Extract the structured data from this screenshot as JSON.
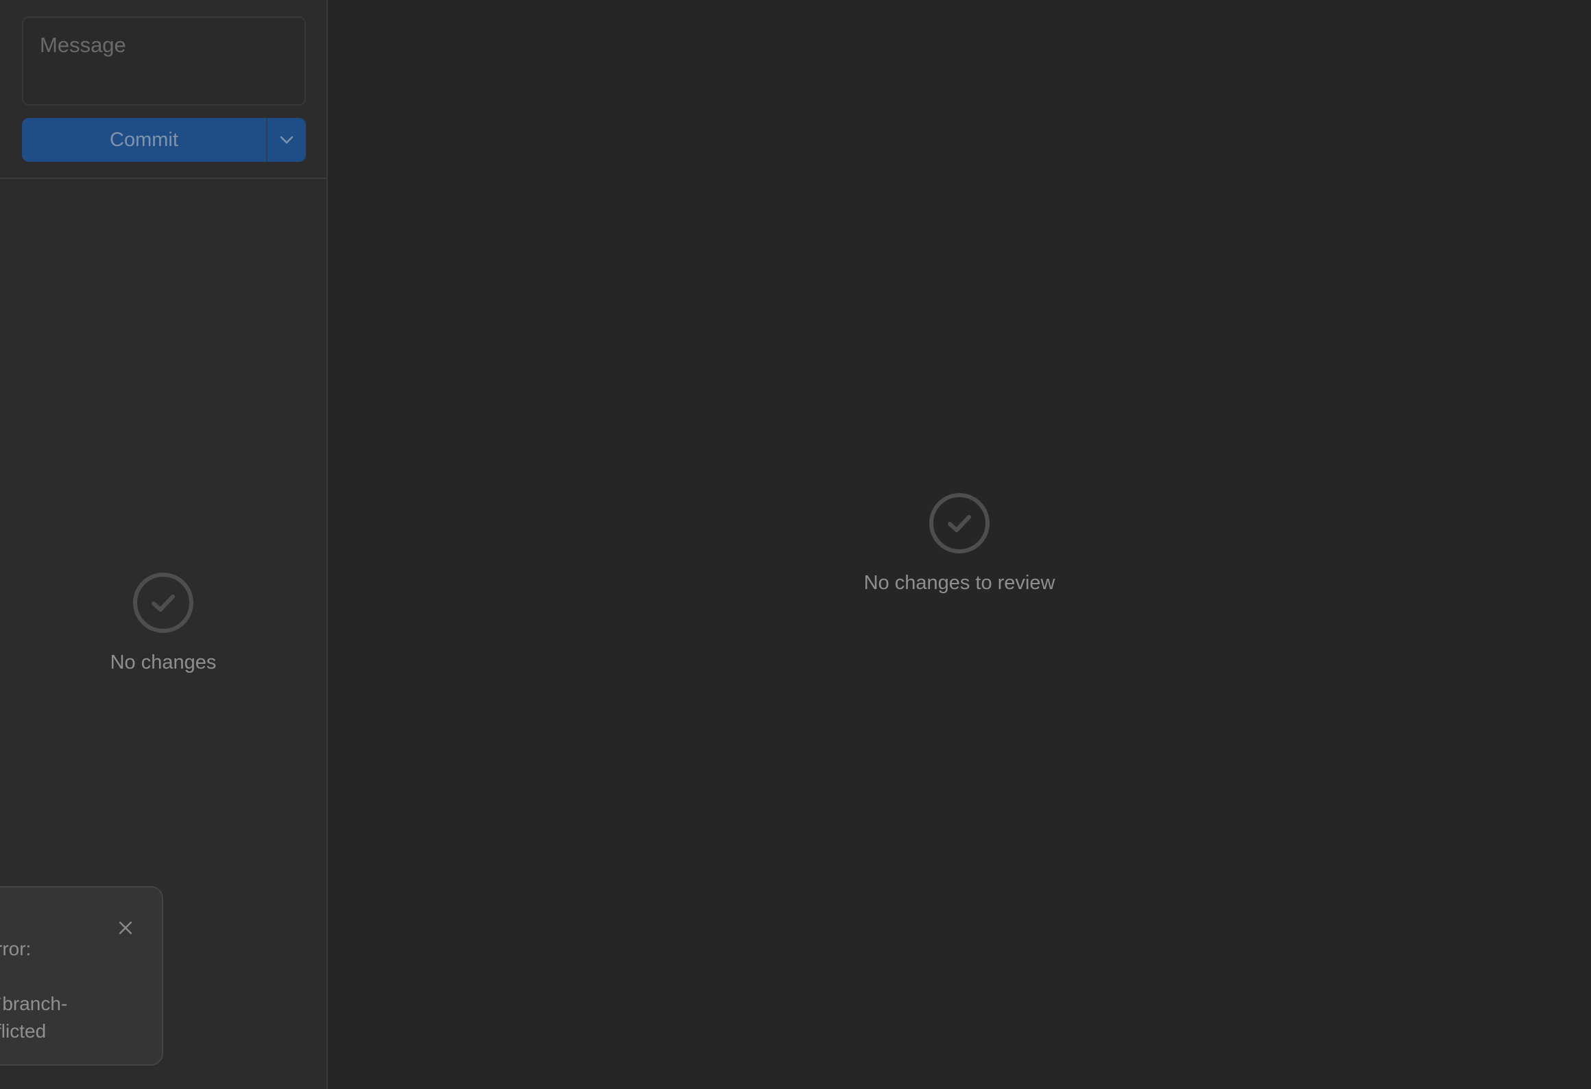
{
  "commit_panel": {
    "message_placeholder": "Message",
    "commit_label": "Commit",
    "menu_icon": "chevron-down-icon"
  },
  "sidebar": {
    "empty_icon": "check-circle-icon",
    "empty_label": "No changes"
  },
  "main": {
    "empty_icon": "check-circle-icon",
    "empty_label": "No changes to review"
  },
  "toast": {
    "close_icon": "close-icon",
    "line1": "rror:",
    "line2": " `branch-",
    "line3": "flicted"
  },
  "colors": {
    "background": "#262626",
    "sidebar": "#2c2c2c",
    "commit_button": "#1f4e86",
    "toast": "#353535"
  }
}
